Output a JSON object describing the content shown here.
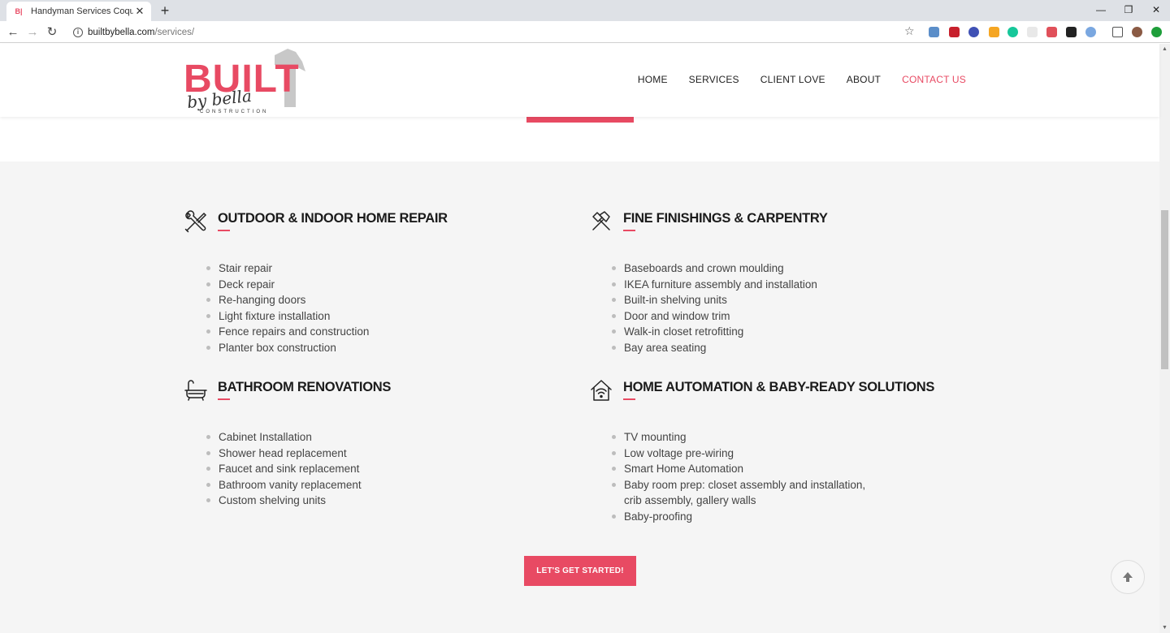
{
  "browser": {
    "tab_title": "Handyman Services Coquitlam | B",
    "tab_favicon": "B|",
    "url_host": "builtbybella.com",
    "url_path": "/services/"
  },
  "logo": {
    "word": "BUILT",
    "script": "by bella",
    "sub": "CONSTRUCTION"
  },
  "nav": {
    "items": [
      {
        "label": "HOME"
      },
      {
        "label": "SERVICES"
      },
      {
        "label": "CLIENT LOVE"
      },
      {
        "label": "ABOUT"
      },
      {
        "label": "CONTACT US"
      }
    ]
  },
  "services": [
    {
      "title": "OUTDOOR & INDOOR HOME REPAIR",
      "icon": "tools-icon",
      "items": [
        "Stair repair",
        "Deck repair",
        "Re-hanging doors",
        "Light fixture installation",
        "Fence repairs and construction",
        "Planter box construction"
      ]
    },
    {
      "title": "FINE FINISHINGS & CARPENTRY",
      "icon": "hammers-icon",
      "items": [
        "Baseboards and crown moulding",
        "IKEA furniture assembly and installation",
        "Built-in shelving units",
        "Door and window trim",
        "Walk-in closet retrofitting",
        "Bay area seating"
      ]
    },
    {
      "title": "BATHROOM RENOVATIONS",
      "icon": "bathtub-icon",
      "items": [
        "Cabinet Installation",
        "Shower head replacement",
        "Faucet and sink replacement",
        "Bathroom vanity replacement",
        "Custom shelving units"
      ]
    },
    {
      "title": "HOME AUTOMATION & BABY-READY SOLUTIONS",
      "icon": "smart-home-icon",
      "items": [
        "TV mounting",
        "Low voltage pre-wiring",
        "Smart Home Automation",
        "Baby room prep: closet assembly and installation,",
        "crib assembly, gallery walls",
        "Baby-proofing"
      ]
    }
  ],
  "cta": {
    "label": "LET'S GET STARTED!"
  },
  "colors": {
    "accent": "#e84a63",
    "section_bg": "#f5f5f5",
    "heading": "#1b1b1b",
    "text": "#444444"
  }
}
